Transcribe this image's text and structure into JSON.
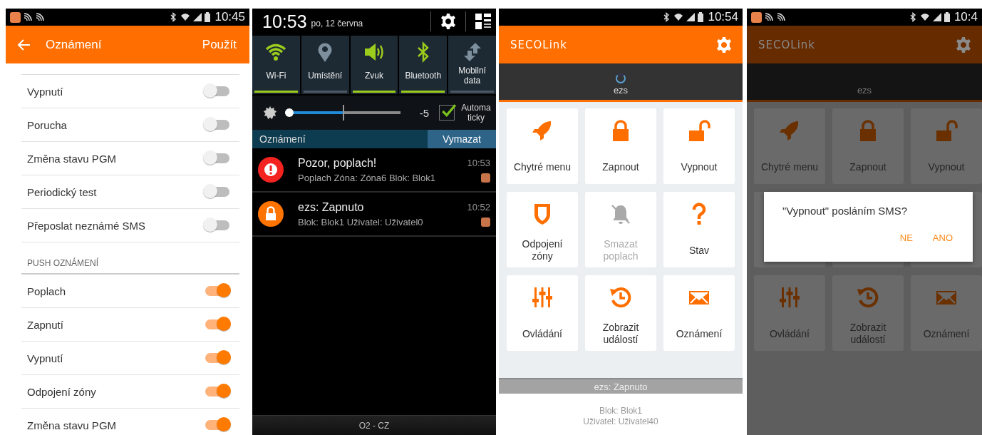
{
  "settings_screen": {
    "status_bar": {
      "time": "10:45",
      "notification_icons": true
    },
    "header": {
      "title": "Oznámení",
      "action": "Použít"
    },
    "sections": [
      {
        "items": [
          {
            "label": "Vypnutí",
            "on": false
          },
          {
            "label": "Porucha",
            "on": false
          },
          {
            "label": "Změna stavu PGM",
            "on": false
          },
          {
            "label": "Periodický test",
            "on": false
          },
          {
            "label": "Přeposlat neznámé SMS",
            "on": false
          }
        ]
      },
      {
        "heading": "PUSH OZNÁMENÍ",
        "items": [
          {
            "label": "Poplach",
            "on": true
          },
          {
            "label": "Zapnutí",
            "on": true
          },
          {
            "label": "Vypnutí",
            "on": true
          },
          {
            "label": "Odpojení zóny",
            "on": true
          },
          {
            "label": "Změna stavu PGM",
            "on": true
          }
        ]
      }
    ]
  },
  "notification_shade": {
    "time": "10:53",
    "date": "po, 12 června",
    "tiles": [
      {
        "kind": "wifi",
        "label": "Wi-Fi",
        "on": true
      },
      {
        "kind": "location",
        "label": "Umístění",
        "on": false
      },
      {
        "kind": "sound",
        "label": "Zvuk",
        "on": true
      },
      {
        "kind": "bluetooth",
        "label": "Bluetooth",
        "on": true
      },
      {
        "kind": "data",
        "label": "Mobilní data",
        "on": false
      }
    ],
    "brightness": {
      "level": 0.5,
      "reading": "-5",
      "auto": {
        "label": "Automaticky",
        "checked": true
      }
    },
    "notifications_header": {
      "title": "Oznámení",
      "button": "Vymazat"
    },
    "notifications": [
      {
        "kind": "alarm",
        "title": "Pozor, poplach!",
        "text": "Poplach Zóna: Zóna6 Blok: Blok1",
        "time": "10:53"
      },
      {
        "kind": "lock",
        "title": "ezs: Zapnuto",
        "text": "Blok: Blok1 Uživatel: Uživatel0",
        "time": "10:52"
      }
    ],
    "carrier": "O2 - CZ"
  },
  "app_screen": {
    "status_bar": {
      "time": "10:54",
      "notification_icons": false
    },
    "logo": "SECOLink",
    "device": {
      "name": "ezs",
      "loading": true
    },
    "tiles": [
      {
        "kind": "rocket",
        "label": "Chytré menu",
        "disabled": false
      },
      {
        "kind": "lock",
        "label": "Zapnout",
        "disabled": false
      },
      {
        "kind": "unlock",
        "label": "Vypnout",
        "disabled": false
      },
      {
        "kind": "shield",
        "label": "Odpojení zóny",
        "disabled": false
      },
      {
        "kind": "bell-off",
        "label": "Smazat poplach",
        "disabled": true
      },
      {
        "kind": "help",
        "label": "Stav",
        "disabled": false
      },
      {
        "kind": "sliders",
        "label": "Ovládání",
        "disabled": false
      },
      {
        "kind": "history",
        "label": "Zobrazit událostí",
        "disabled": false
      },
      {
        "kind": "mail",
        "label": "Oznámení",
        "disabled": false
      }
    ],
    "status": "ezs: Zapnuto",
    "details": [
      "Blok: Blok1",
      "Uživatel: Uživatel40"
    ]
  },
  "dialog_screen": {
    "status_bar": {
      "time": "10:4",
      "notification_icons": true
    },
    "logo": "SECOLink",
    "device": {
      "name": "ezs",
      "loading": false
    },
    "tiles": [
      {
        "kind": "rocket",
        "label": "Chytré menu"
      },
      {
        "kind": "lock",
        "label": "Zapnout"
      },
      {
        "kind": "unlock",
        "label": "Vypnout"
      },
      {
        "kind": "sliders",
        "label": "Ovládání"
      },
      {
        "kind": "history",
        "label": "Zobrazit událostí"
      },
      {
        "kind": "mail",
        "label": "Oznámení"
      }
    ],
    "dialog": {
      "message": "\"Vypnout\" posláním SMS?",
      "buttons": [
        "NE",
        "ANO"
      ]
    }
  }
}
